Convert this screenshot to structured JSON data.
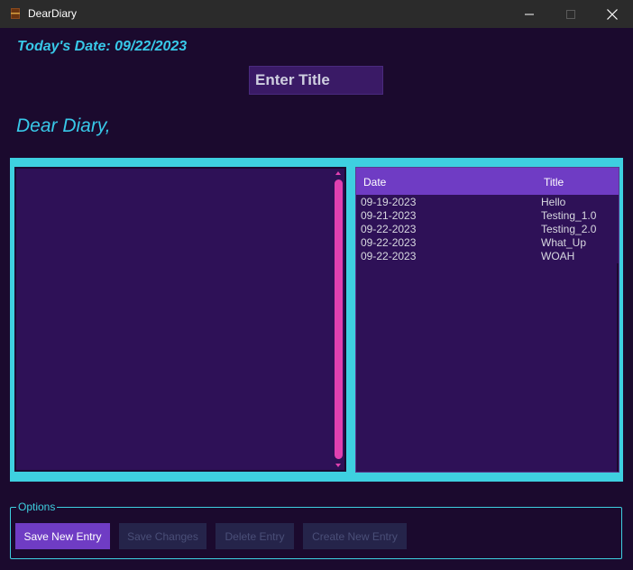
{
  "window": {
    "title": "DearDiary",
    "icon": "book-icon"
  },
  "header": {
    "date_label": "Today's Date: 09/22/2023",
    "title_placeholder": "Enter Title",
    "greeting": "Dear Diary,"
  },
  "entries_table": {
    "columns": [
      "Date",
      "Title"
    ],
    "rows": [
      {
        "date": "09-19-2023",
        "title": "Hello"
      },
      {
        "date": "09-21-2023",
        "title": "Testing_1.0"
      },
      {
        "date": "09-22-2023",
        "title": "Testing_2.0"
      },
      {
        "date": "09-22-2023",
        "title": "What_Up"
      },
      {
        "date": "09-22-2023",
        "title": "WOAH"
      }
    ]
  },
  "options": {
    "label": "Options",
    "buttons": {
      "save_new": "Save New Entry",
      "save_changes": "Save Changes",
      "delete": "Delete Entry",
      "create_new": "Create New Entry"
    }
  },
  "colors": {
    "accent_cyan": "#3ed0e0",
    "accent_purple": "#6f3cc4",
    "scroll_pink": "#e040b0",
    "background": "#1b0a2e"
  }
}
